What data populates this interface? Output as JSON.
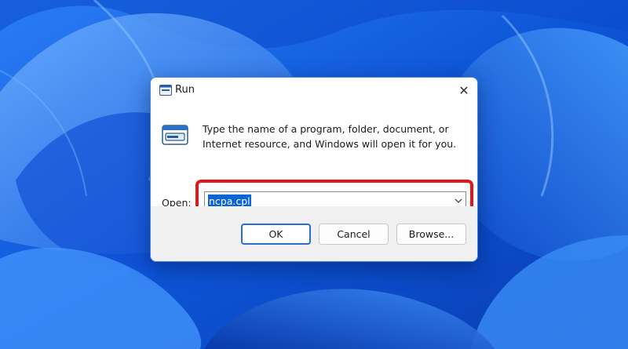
{
  "dialog": {
    "title": "Run",
    "close_glyph": "✕",
    "description": "Type the name of a program, folder, document, or Internet resource, and Windows will open it for you.",
    "open_label_accel": "O",
    "open_label_rest": "pen:",
    "open_value": "ncpa.cpl",
    "buttons": {
      "ok": "OK",
      "cancel": "Cancel",
      "browse": "Browse..."
    }
  },
  "icons": {
    "title": "run-app-icon",
    "main": "run-window-icon",
    "close": "close-icon",
    "dropdown": "chevron-down-icon"
  },
  "colors": {
    "wallpaper_blue": "#1560e8",
    "highlight_red": "#e8141c",
    "selection_blue": "#0a64d8",
    "primary_button_border": "#2a6bd6"
  }
}
